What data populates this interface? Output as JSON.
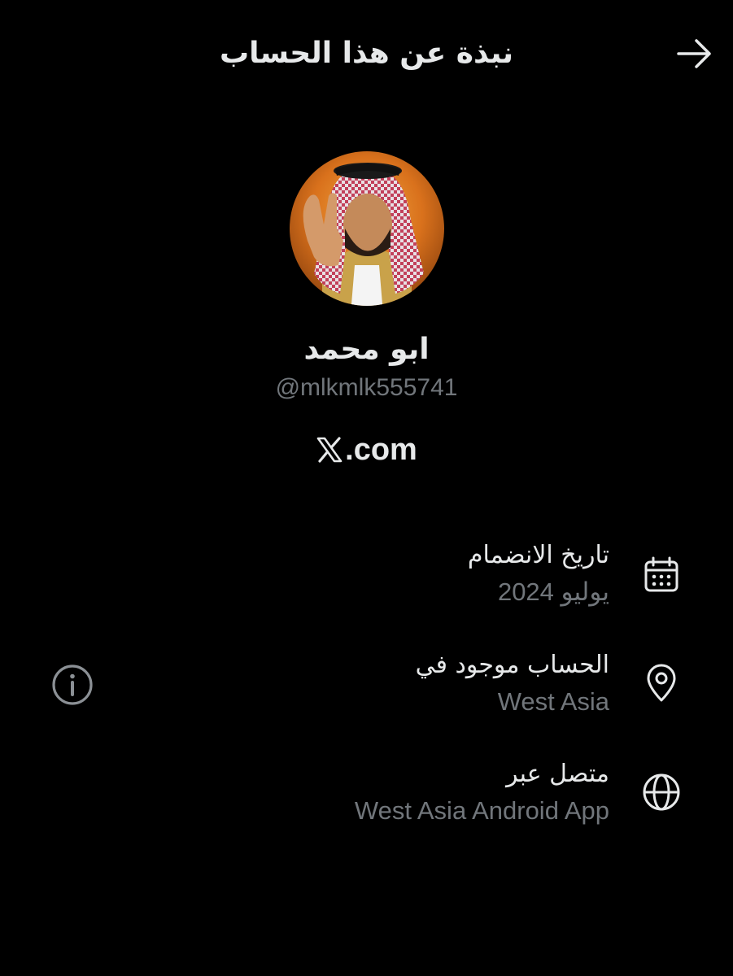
{
  "header": {
    "title": "نبذة عن هذا الحساب",
    "back_icon": "arrow-right-icon"
  },
  "profile": {
    "display_name": "ابو محمد",
    "handle": "@mlkmlk555741",
    "site_logo_icon": "x-logo-icon",
    "site_suffix": ".com"
  },
  "details": [
    {
      "title": "تاريخ الانضمام",
      "value": "يوليو 2024",
      "icon": "calendar-icon"
    },
    {
      "title": "الحساب موجود في",
      "value": "West Asia",
      "icon": "location-pin-icon"
    },
    {
      "title": "متصل عبر",
      "value": "West Asia Android App",
      "icon": "globe-icon"
    }
  ],
  "info_icon": "info-icon",
  "colors": {
    "background": "#000000",
    "primary_text": "#e7e9ea",
    "secondary_text": "#71767b"
  }
}
